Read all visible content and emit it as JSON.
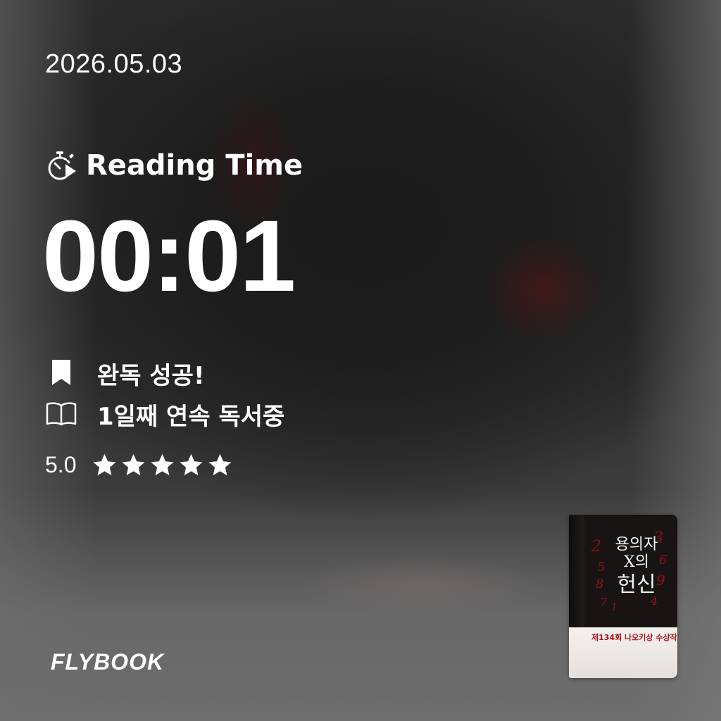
{
  "date": "2026.05.03",
  "reading_time": {
    "label": "Reading Time",
    "icon": "stopwatch-play-icon",
    "value": "00:01"
  },
  "status": {
    "complete_label": "완독 성공!",
    "complete_icon": "bookmark-icon",
    "streak_label": "1일째 연속 독서중",
    "streak_icon": "open-book-icon"
  },
  "rating": {
    "value": "5.0",
    "stars_filled": 5,
    "stars_total": 5
  },
  "brand": {
    "name": "FLYBOOK"
  },
  "book": {
    "title_line1": "용의자",
    "title_line2": "X의",
    "title_line3": "헌신",
    "award": "제134회 나오키상 수상작"
  },
  "colors": {
    "text": "#ffffff",
    "award_red": "#b3121d",
    "cover_dark": "#181414"
  }
}
